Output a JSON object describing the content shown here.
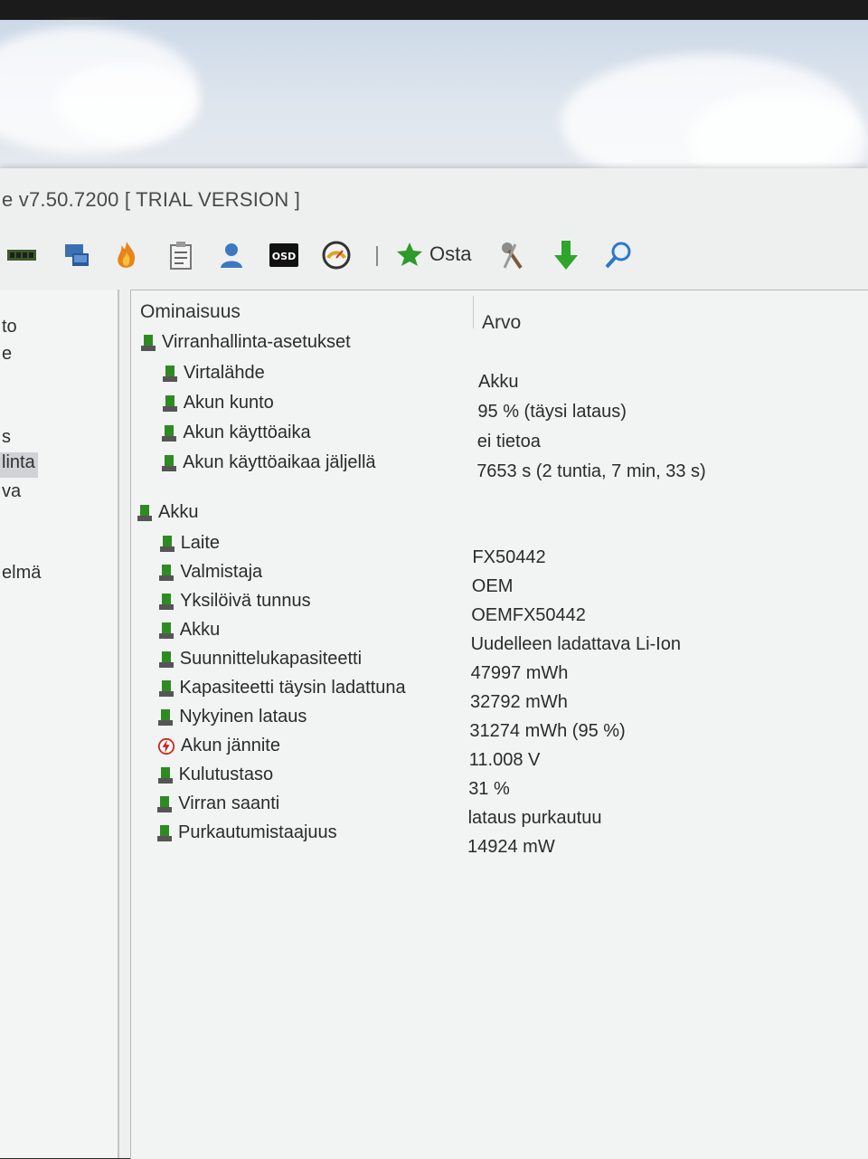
{
  "window": {
    "title": "e v7.50.7200  [ TRIAL VERSION ]"
  },
  "toolbar": {
    "buy_label": "Osta",
    "icons": [
      "memory-icon",
      "network-icon",
      "flame-icon",
      "report-icon",
      "user-icon",
      "osd-icon",
      "gauge-icon",
      "buy-star-icon",
      "tools-icon",
      "download-arrow-icon",
      "search-icon"
    ]
  },
  "sidebar": {
    "items": [
      "to",
      "e",
      "s",
      "linta",
      "va",
      "elmä"
    ],
    "selected_index": 3
  },
  "table": {
    "columns": [
      "Ominaisuus",
      "Arvo"
    ],
    "groups": [
      {
        "name": "Virranhallinta-asetukset",
        "rows": [
          {
            "label": "Virtalähde",
            "value": "Akku"
          },
          {
            "label": "Akun kunto",
            "value": "95 % (täysi lataus)"
          },
          {
            "label": "Akun käyttöaika",
            "value": "ei tietoa"
          },
          {
            "label": "Akun käyttöaikaa jäljellä",
            "value": "7653 s (2 tuntia, 7 min, 33 s)"
          }
        ]
      },
      {
        "name": "Akku",
        "rows": [
          {
            "label": "Laite",
            "value": "FX50442"
          },
          {
            "label": "Valmistaja",
            "value": "OEM"
          },
          {
            "label": "Yksilöivä tunnus",
            "value": "OEMFX50442"
          },
          {
            "label": "Akku",
            "value": "Uudelleen ladattava Li-Ion"
          },
          {
            "label": "Suunnittelukapasiteetti",
            "value": "47997 mWh"
          },
          {
            "label": "Kapasiteetti täysin ladattuna",
            "value": "32792 mWh"
          },
          {
            "label": "Nykyinen lataus",
            "value": "31274 mWh  (95 %)"
          },
          {
            "label": "Akun jännite",
            "value": "11.008 V",
            "icon": "voltage-icon"
          },
          {
            "label": "Kulutustaso",
            "value": "31 %"
          },
          {
            "label": "Virran saanti",
            "value": "lataus purkautuu"
          },
          {
            "label": "Purkautumistaajuus",
            "value": "14924 mW"
          }
        ]
      }
    ]
  },
  "colors": {
    "battery_icon": "#2e8b22",
    "voltage_icon": "#d0261c",
    "selection": "#cfd3d6"
  }
}
